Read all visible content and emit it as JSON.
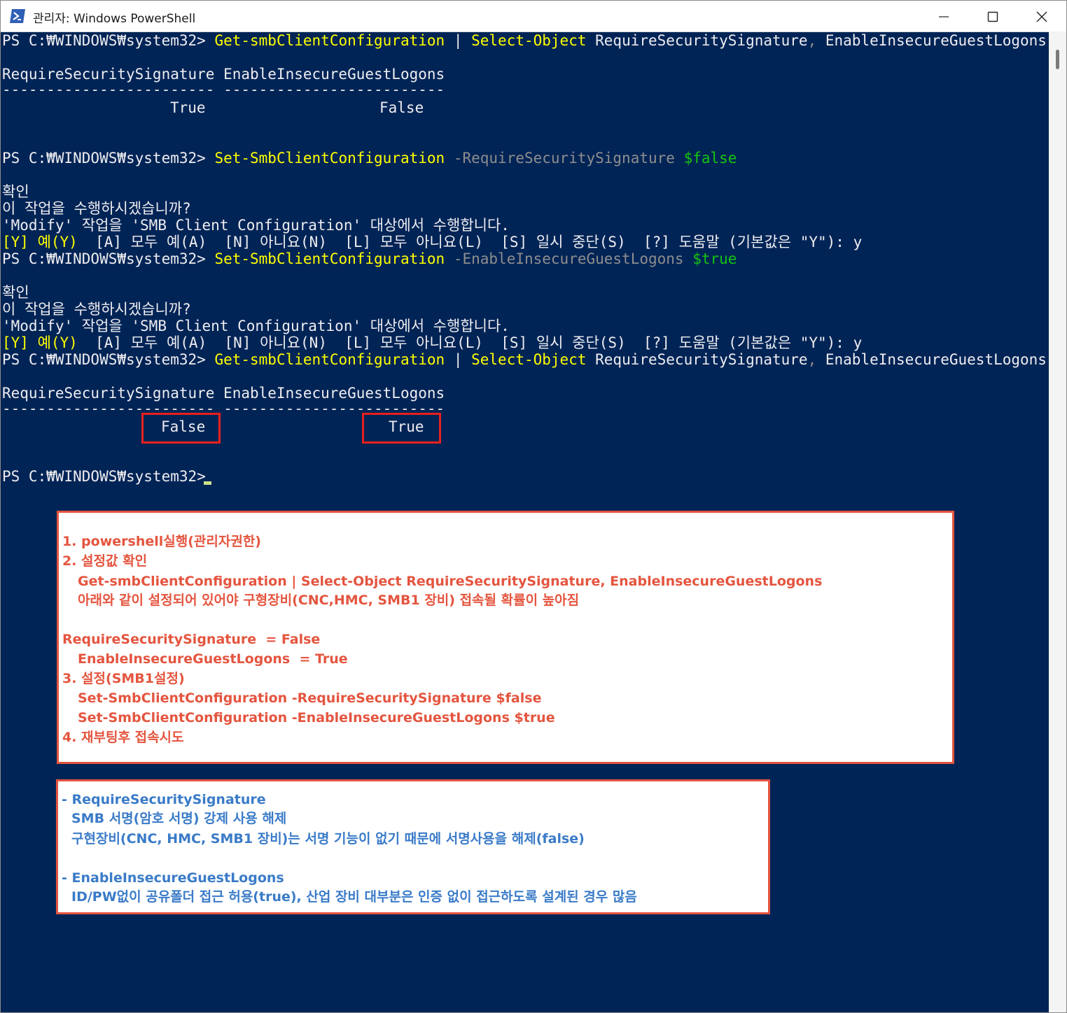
{
  "window": {
    "title": "관리자: Windows PowerShell"
  },
  "console": {
    "prompt": "PS C:₩WINDOWS₩system32>",
    "lines": {
      "l1_cmd": "Get-smbClientConfiguration",
      "l1_pipe": " | ",
      "l1_select": "Select-Object",
      "l1_args": " RequireSecuritySignature",
      "l1_comma": ",",
      "l1_args2": " EnableInsecureGuestLogons",
      "header": "RequireSecuritySignature EnableInsecureGuestLogons",
      "divider": "------------------------ -------------------------",
      "row1_a": "True",
      "row1_b": "False",
      "l2_cmd": "Set-SmbClientConfiguration",
      "l2_param": " -RequireSecuritySignature",
      "l2_val": " $false",
      "confirm": "확인",
      "question": "이 작업을 수행하시겠습니까?",
      "modify": "'Modify' 작업을 'SMB Client Configuration' 대상에서 수행합니다.",
      "opt_yes": "[Y] 예(Y)",
      "opt_rest": "  [A] 모두 예(A)  [N] 아니요(N)  [L] 모두 아니요(L)  [S] 일시 중단(S)  [?] 도움말 (기본값은 \"Y\"): y",
      "l3_cmd": "Set-SmbClientConfiguration",
      "l3_param": " -EnableInsecureGuestLogons",
      "l3_val": " $true",
      "row2_a": "False",
      "row2_b": "True"
    }
  },
  "note1": {
    "line1": "1. powershell실행(관리자권한)",
    "line2": "2. 설정값 확인",
    "line3": "Get-smbClientConfiguration | Select-Object RequireSecuritySignature, EnableInsecureGuestLogons",
    "line4": "아래와 같이 설정되어 있어야 구형장비(CNC,HMC, SMB1 장비) 접속될 확률이 높아짐",
    "line5": "RequireSecuritySignature  = False",
    "line6": "EnableInsecureGuestLogons  = True",
    "line7": "3. 설정(SMB1설정)",
    "line8": "Set-SmbClientConfiguration -RequireSecuritySignature $false",
    "line9": "Set-SmbClientConfiguration -EnableInsecureGuestLogons $true",
    "line10": "4. 재부팅후 접속시도"
  },
  "note2": {
    "line1": "- RequireSecuritySignature",
    "line2": "SMB 서명(암호 서명) 강제 사용 해제",
    "line3": "구현장비(CNC, HMC, SMB1 장비)는 서명 기능이 없기 때문에 서명사용을 해제(false)",
    "line4": "- EnableInsecureGuestLogons",
    "line5": "ID/PW없이 공유폴더 접근 허용(true), 산업 장비 대부분은 인증 없이 접근하도록 설계된 경우 많음"
  },
  "colors": {
    "console_bg": "#012456",
    "command_yellow": "#ffff00",
    "value_green": "#13c60e",
    "param_gray": "#8e8e8e",
    "highlight_red": "#e8201c",
    "note_red": "#e4553f",
    "note_blue": "#3a7bc8"
  }
}
